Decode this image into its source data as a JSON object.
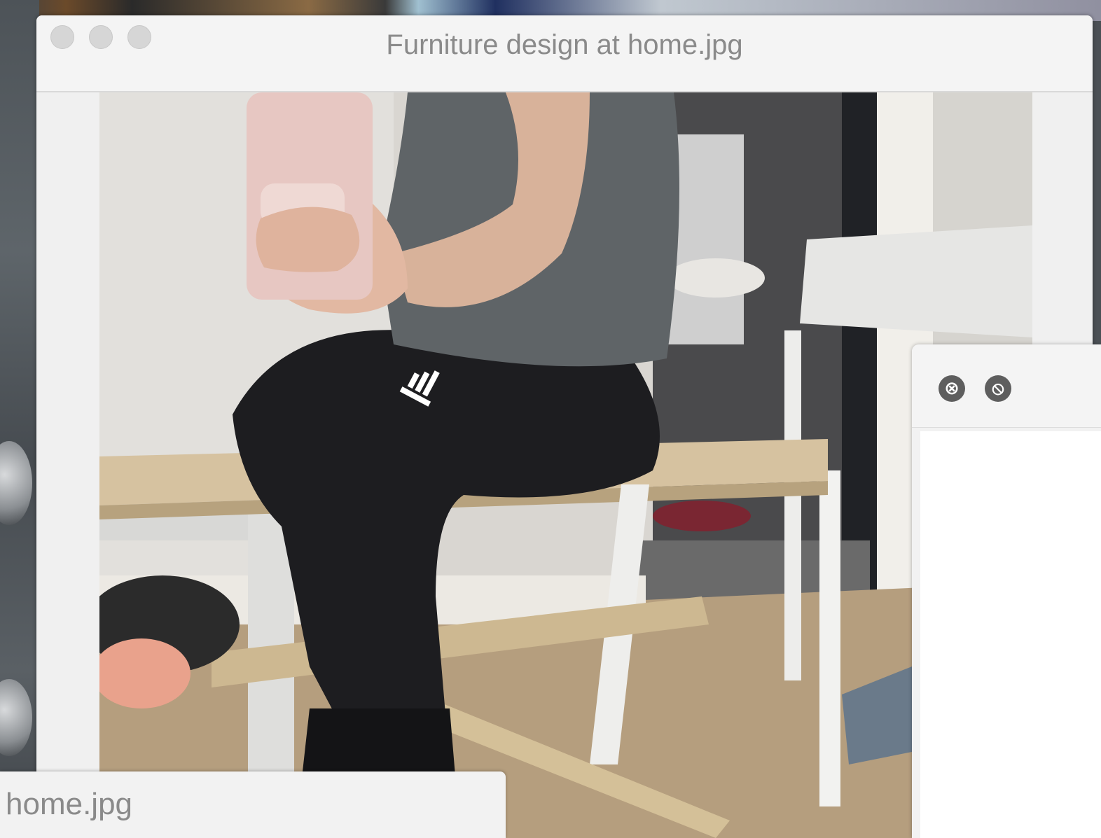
{
  "window": {
    "title": "Furniture design at home.jpg",
    "controls": [
      "close",
      "minimize",
      "zoom"
    ]
  },
  "image": {
    "alt": "Furniture design at home.jpg"
  },
  "file_window": {
    "filename": "home.jpg"
  },
  "side_panel": {
    "close_symbol": "⊗",
    "block_symbol": "⦸"
  },
  "colors": {
    "titlebar": "#f4f4f4",
    "title_text": "#8a8a8a",
    "panel_button": "#5e5e5e"
  }
}
